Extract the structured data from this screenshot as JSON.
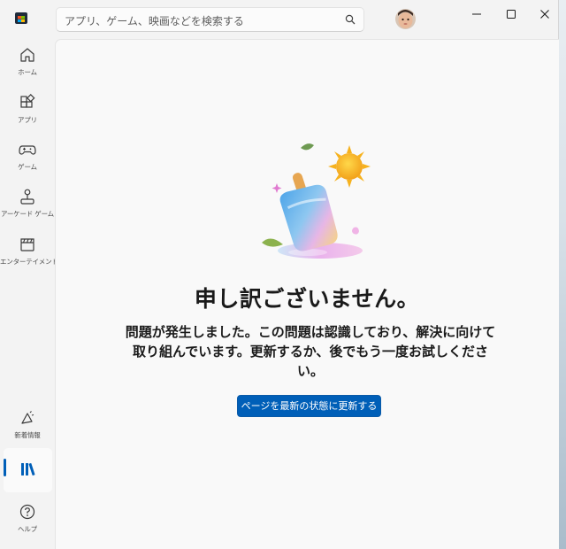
{
  "search": {
    "placeholder": "アプリ、ゲーム、映画などを検索する"
  },
  "sidebar": {
    "items": [
      {
        "label": "ホーム"
      },
      {
        "label": "アプリ"
      },
      {
        "label": "ゲーム"
      },
      {
        "label": "アーケード ゲーム"
      },
      {
        "label": "エンターテイメント"
      }
    ],
    "bottom_items": [
      {
        "label": "新着情報"
      },
      {
        "label": ""
      },
      {
        "label": "ヘルプ"
      }
    ]
  },
  "error": {
    "title": "申し訳ございません。",
    "message": "問題が発生しました。この問題は認識しており、解決に向けて取り組んでいます。更新するか、後でもう一度お試しください。",
    "button_label": "ページを最新の状態に更新する"
  },
  "colors": {
    "accent": "#005fb8",
    "background": "#f9f9f9"
  }
}
